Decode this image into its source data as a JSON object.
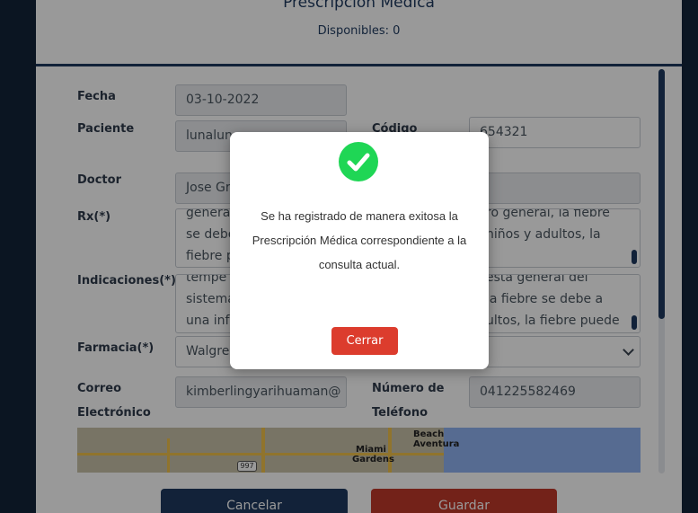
{
  "header": {
    "title": "Prescripción Médica",
    "available": "Disponibles: 0"
  },
  "form": {
    "fecha": {
      "label": "Fecha",
      "value": "03-10-2022"
    },
    "paciente": {
      "label": "Paciente",
      "value": "lunalun"
    },
    "codigo": {
      "label": "Código",
      "value": "654321"
    },
    "doctor": {
      "label": "Doctor",
      "value": "Jose Gr"
    },
    "rx": {
      "label": "Rx(*)",
      "lines": [
        "genera",
        "se debe",
        "fiebre p"
      ],
      "lines_right": [
        "ro general, la fiebre",
        "niños y adultos, la",
        ""
      ]
    },
    "indicaciones": {
      "label": "Indicaciones(*)",
      "lines": [
        "tempe",
        "sistema",
        "una inf"
      ],
      "lines_right": [
        "esta general del",
        "la fiebre se debe a",
        "ultos, la fiebre puede"
      ]
    },
    "farmacia": {
      "label": "Farmacia(*)",
      "value": "Walgre"
    },
    "correo": {
      "label_line1": "Correo",
      "label_line2": "Electrónico",
      "value": "kimberlingyarihuaman@"
    },
    "telefono": {
      "label_line1": "Número de",
      "label_line2": "Teléfono",
      "value": "041225582469"
    }
  },
  "map": {
    "labels": {
      "beach": "Beach",
      "aventura": "Aventura",
      "miami": "Miami",
      "gardens": "Gardens",
      "road_shield": "997"
    }
  },
  "actions": {
    "cancel_label": "Cancelar",
    "save_label": "Guardar"
  },
  "modal": {
    "icon": "check-circle-icon",
    "message": "Se ha registrado de manera exitosa la Prescripción Médica correspondiente a la consulta actual.",
    "close_label": "Cerrar"
  },
  "colors": {
    "primary": "#1e3a5f",
    "danger": "#c0392b",
    "success": "#1fd655"
  }
}
